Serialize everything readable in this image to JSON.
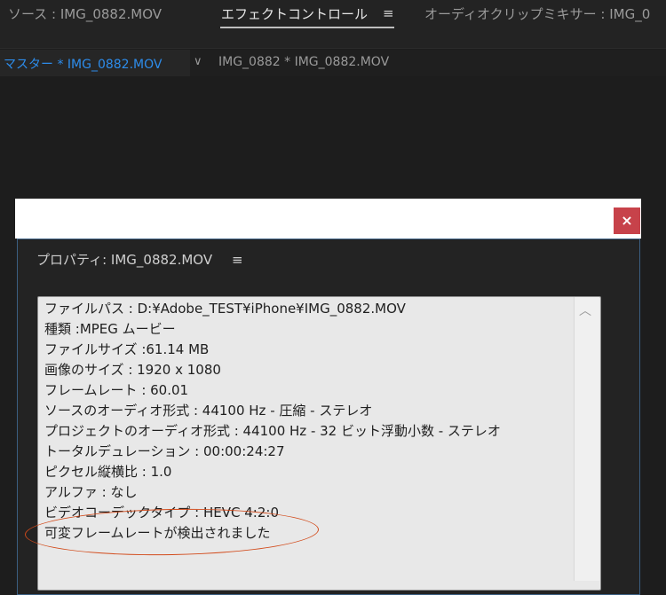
{
  "tabs": [
    {
      "label": "ソース : IMG_0882.MOV"
    },
    {
      "label": "エフェクトコントロール"
    },
    {
      "label": "オーディオクリップミキサー : IMG_0"
    }
  ],
  "sequence_bar": {
    "master_label": "マスター * IMG_0882.MOV",
    "clip_label": "IMG_0882 * IMG_0882.MOV"
  },
  "dialog": {
    "close_symbol": "×",
    "title": "プロパティ: IMG_0882.MOV",
    "properties": [
      "ファイルパス : D:¥Adobe_TEST¥iPhone¥IMG_0882.MOV",
      "種類 :MPEG ムービー",
      "ファイルサイズ :61.14 MB",
      "画像のサイズ : 1920 x 1080",
      "フレームレート : 60.01",
      "ソースのオーディオ形式 : 44100 Hz - 圧縮 - ステレオ",
      "プロジェクトのオーディオ形式 : 44100 Hz - 32 ビット浮動小数 - ステレオ",
      "トータルデュレーション : 00:00:24:27",
      "ピクセル縦横比 : 1.0",
      "アルファ : なし",
      "ビデオコーデックタイプ : HEVC 4:2:0",
      "可変フレームレートが検出されました"
    ]
  },
  "icons": {
    "menu": "≡",
    "chevron": "∨",
    "scroll_up": "︿"
  },
  "colors": {
    "accent_blue": "#2d8ceb",
    "close_red": "#c7424a",
    "annotation_orange": "#d24a1a"
  }
}
